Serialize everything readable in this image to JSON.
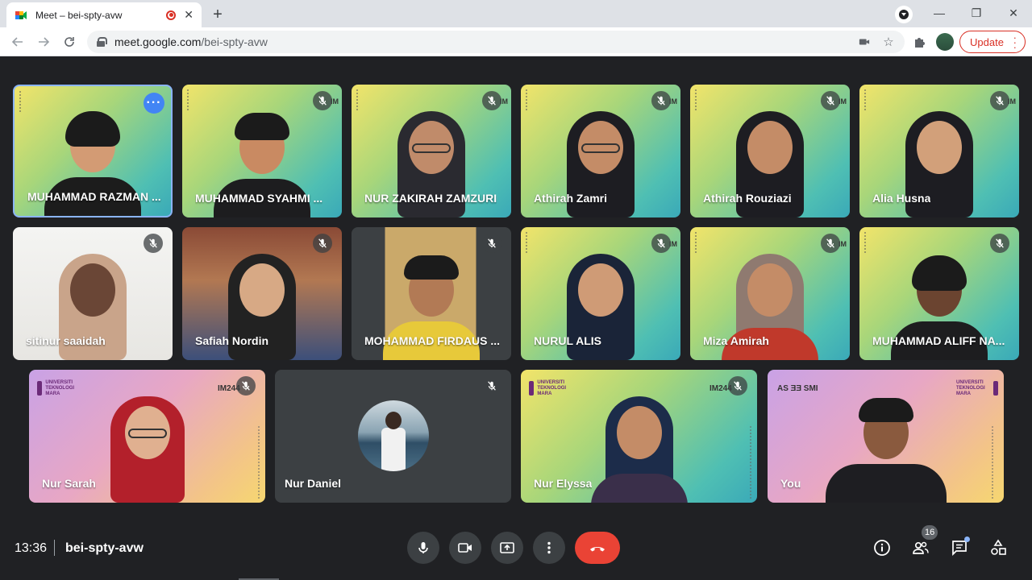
{
  "browser": {
    "tab_title": "Meet – bei-spty-avw",
    "new_tab": "+",
    "url_host": "meet.google.com",
    "url_path": "/bei-spty-avw",
    "update_label": "Update",
    "minimize": "—",
    "restore": "❐",
    "close": "✕"
  },
  "tiles": [
    {
      "name": "MUHAMMAD RAZMAN ...",
      "bg": "teal",
      "muted": false,
      "active": true
    },
    {
      "name": "MUHAMMAD SYAHMI ...",
      "bg": "teal",
      "muted": true
    },
    {
      "name": "NUR ZAKIRAH ZAMZURI",
      "bg": "teal",
      "muted": true
    },
    {
      "name": "Athirah Zamri",
      "bg": "teal",
      "muted": true
    },
    {
      "name": "Athirah Rouziazi",
      "bg": "teal",
      "muted": true
    },
    {
      "name": "Alia Husna",
      "bg": "teal",
      "muted": true
    },
    {
      "name": "sitinur saaidah",
      "bg": "white",
      "muted": true
    },
    {
      "name": "Safiah Nordin",
      "bg": "room",
      "muted": true
    },
    {
      "name": "MOHAMMAD FIRDAUS ...",
      "bg": "wood",
      "muted": true
    },
    {
      "name": "NURUL ALIS",
      "bg": "teal",
      "muted": true
    },
    {
      "name": "Miza Amirah",
      "bg": "teal",
      "muted": true
    },
    {
      "name": "MUHAMMAD ALIFF NA...",
      "bg": "teal",
      "muted": true
    },
    {
      "name": "Nur Sarah",
      "bg": "pink",
      "muted": true
    },
    {
      "name": "Nur Daniel",
      "bg": "grey",
      "muted": true
    },
    {
      "name": "Nur Elyssa",
      "bg": "teal",
      "muted": true
    },
    {
      "name": "You",
      "bg": "pink",
      "muted": false
    }
  ],
  "overlay_text": {
    "im_short": "IM",
    "im244": "IM244",
    "im244_mirrored": "AS ƎƎ SMI",
    "crest_text": "UNIVERSITI TEKNOLOGI MARA"
  },
  "bottom": {
    "time": "13:36",
    "meeting_code": "bei-spty-avw",
    "participants_count": "16"
  }
}
